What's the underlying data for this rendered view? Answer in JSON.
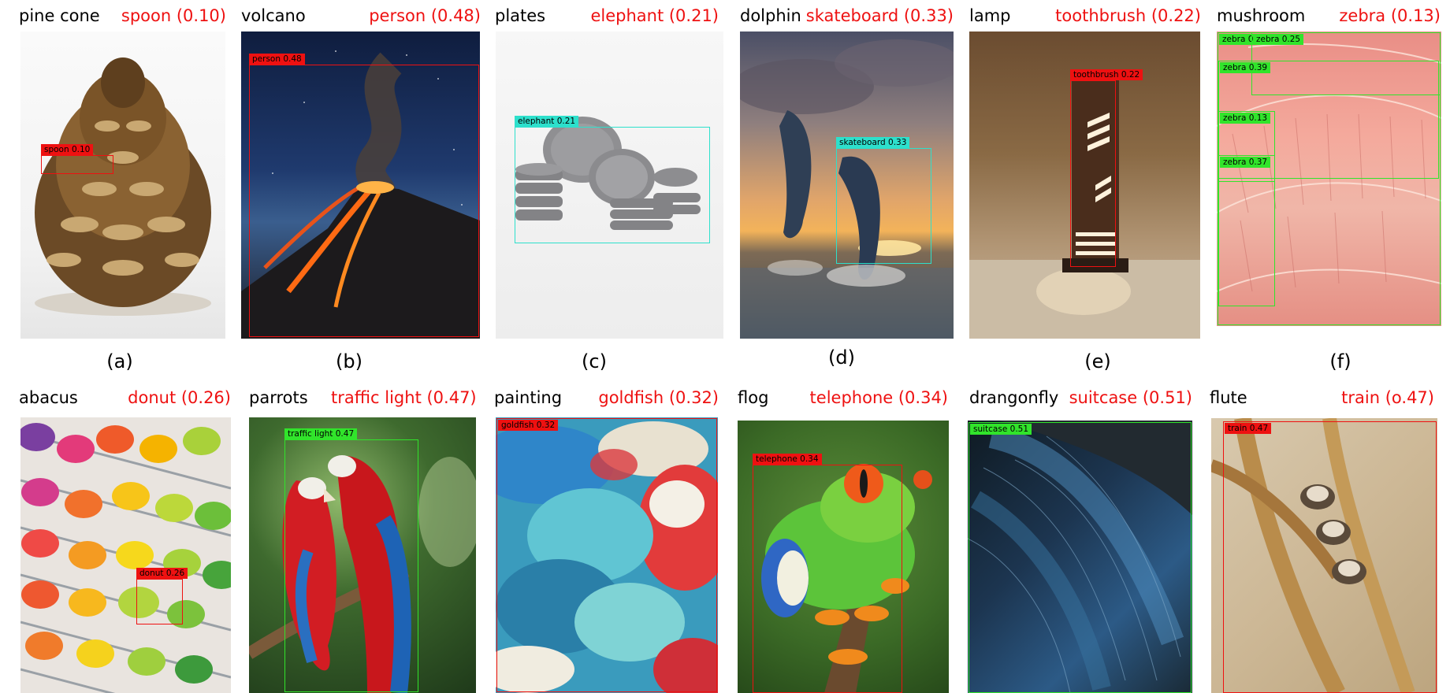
{
  "colors": {
    "prediction_text": "#ee1111",
    "red_box": "#ee1111",
    "cyan_box": "#2de0cc",
    "green_box": "#31e42b"
  },
  "panels": [
    {
      "name": "pine cone",
      "prediction": "spoon (0.10)",
      "subcaption": "(a)",
      "boxes": [
        {
          "label": "spoon 0.10"
        }
      ]
    },
    {
      "name": "volcano",
      "prediction": "person (0.48)",
      "subcaption": "(b)",
      "boxes": [
        {
          "label": "person 0.48"
        }
      ]
    },
    {
      "name": "plates",
      "prediction": "elephant (0.21)",
      "subcaption": "(c)",
      "boxes": [
        {
          "label": "elephant 0.21"
        }
      ]
    },
    {
      "name": "dolphin",
      "prediction": "skateboard (0.33)",
      "subcaption": "(d)",
      "boxes": [
        {
          "label": "skateboard 0.33"
        }
      ]
    },
    {
      "name": "lamp",
      "prediction": "toothbrush (0.22)",
      "subcaption": "(e)",
      "boxes": [
        {
          "label": "toothbrush 0.22"
        }
      ]
    },
    {
      "name": "mushroom",
      "prediction": "zebra (0.13)",
      "subcaption": "(f)",
      "boxes": [
        {
          "label": "zebra 0.32"
        },
        {
          "label": "zebra 0.25"
        },
        {
          "label": "zebra 0.39"
        },
        {
          "label": "zebra 0.13"
        },
        {
          "label": "zebra 0.37"
        }
      ]
    },
    {
      "name": "abacus",
      "prediction": "donut (0.26)",
      "boxes": [
        {
          "label": "donut 0.26"
        }
      ]
    },
    {
      "name": "parrots",
      "prediction": "traffic light (0.47)",
      "boxes": [
        {
          "label": "traffic light 0.47"
        }
      ]
    },
    {
      "name": "painting",
      "prediction": "goldfish (0.32)",
      "boxes": [
        {
          "label": "goldfish 0.32"
        }
      ]
    },
    {
      "name": "flog",
      "prediction": "telephone (0.34)",
      "boxes": [
        {
          "label": "telephone 0.34"
        }
      ]
    },
    {
      "name": "drangonfly",
      "prediction": "suitcase (0.51)",
      "boxes": [
        {
          "label": "suitcase 0.51"
        }
      ]
    },
    {
      "name": "flute",
      "prediction": "train (o.47)",
      "boxes": [
        {
          "label": "train 0.47"
        }
      ]
    }
  ]
}
